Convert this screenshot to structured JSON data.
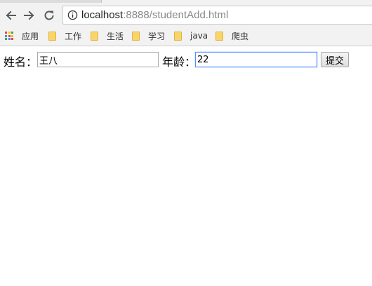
{
  "browser": {
    "url_host": "localhost",
    "url_rest": ":8888/studentAdd.html",
    "icons": {
      "back": "arrow-left-icon",
      "forward": "arrow-right-icon",
      "reload": "reload-icon",
      "info": "info-icon"
    }
  },
  "bookmarks": {
    "apps_label": "应用",
    "items": [
      {
        "label": "工作",
        "icon": "folder-icon"
      },
      {
        "label": "生活",
        "icon": "folder-icon"
      },
      {
        "label": "学习",
        "icon": "folder-icon"
      },
      {
        "label": "java",
        "icon": "folder-icon"
      },
      {
        "label": "爬虫",
        "icon": "folder-icon"
      }
    ],
    "folder_color": "#f8d46a"
  },
  "form": {
    "name_label": "姓名：",
    "name_value": "王八",
    "age_label": "年龄：",
    "age_value": "22",
    "submit_label": "提交"
  },
  "colors": {
    "focus_border": "#4d90fe",
    "chrome_bg": "#f2f2f2"
  }
}
